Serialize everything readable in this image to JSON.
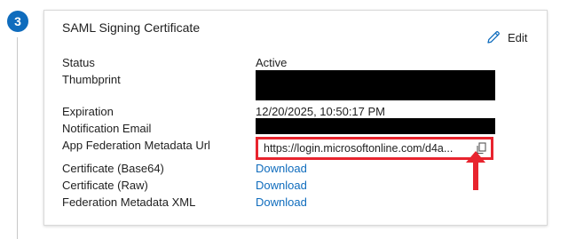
{
  "step": {
    "number": "3"
  },
  "card": {
    "title": "SAML Signing Certificate",
    "edit_label": "Edit"
  },
  "fields": {
    "status_label": "Status",
    "status_value": "Active",
    "thumbprint_label": "Thumbprint",
    "expiration_label": "Expiration",
    "expiration_value": "12/20/2025, 10:50:17 PM",
    "notification_email_label": "Notification Email",
    "metadata_url_label": "App Federation Metadata Url",
    "metadata_url_value": "https://login.microsoftonline.com/d4a...",
    "cert_base64_label": "Certificate (Base64)",
    "cert_raw_label": "Certificate (Raw)",
    "federation_xml_label": "Federation Metadata XML",
    "download_label": "Download"
  },
  "colors": {
    "accent": "#0f6cbd",
    "highlight": "#e8242e",
    "redaction": "#000000"
  },
  "icons": {
    "edit": "pencil-icon",
    "copy": "copy-icon"
  }
}
